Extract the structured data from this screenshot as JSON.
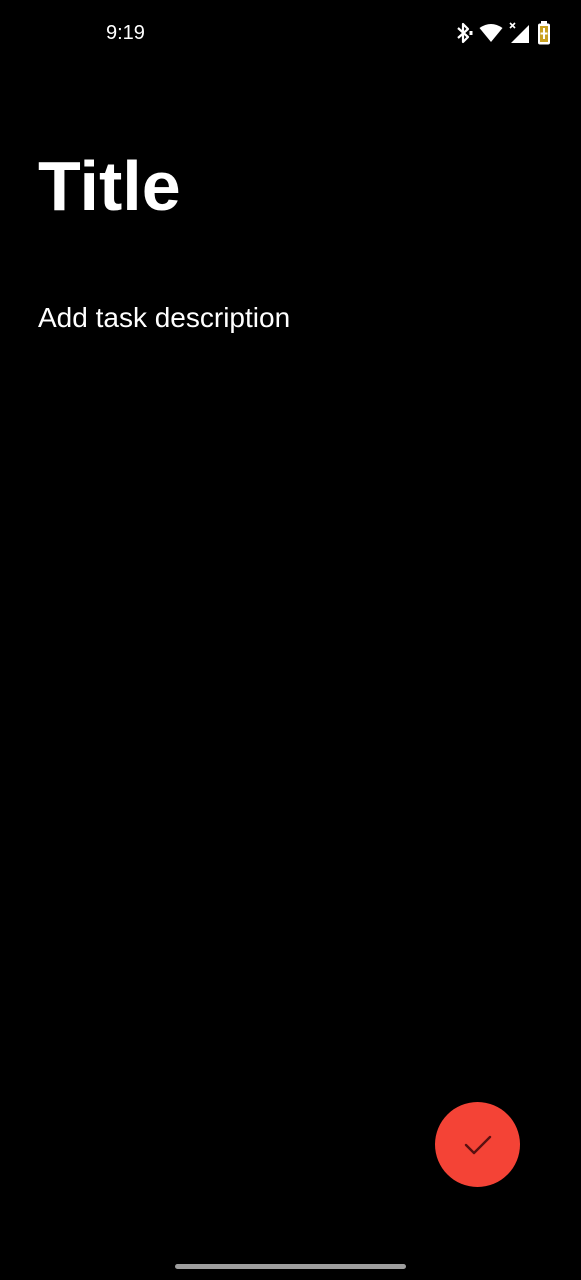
{
  "status_bar": {
    "time": "9:19",
    "icons": [
      "bluetooth-icon",
      "wifi-icon",
      "cellular-signal-icon",
      "battery-icon"
    ]
  },
  "editor": {
    "title_placeholder": "Title",
    "description_placeholder": "Add task description"
  },
  "fab": {
    "icon": "checkmark-icon",
    "color": "#f44336",
    "icon_color": "#5a1010"
  },
  "theme": {
    "background": "#000000",
    "text": "#ffffff"
  }
}
